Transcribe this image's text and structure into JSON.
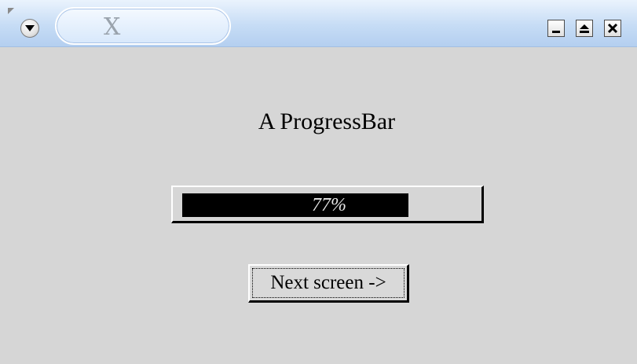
{
  "window": {
    "title": "X",
    "icons": {
      "menu": "chevron-down-icon",
      "minimize": "minimize-icon",
      "maximize": "maximize-icon",
      "close": "close-icon"
    }
  },
  "main": {
    "heading": "A ProgressBar",
    "progress": {
      "value": 0.77,
      "label": "77%"
    },
    "next_button_label": "Next screen ->"
  },
  "colors": {
    "titlebar": "#c6dcf5",
    "background": "#d6d6d6",
    "progress_fill": "#000000"
  }
}
